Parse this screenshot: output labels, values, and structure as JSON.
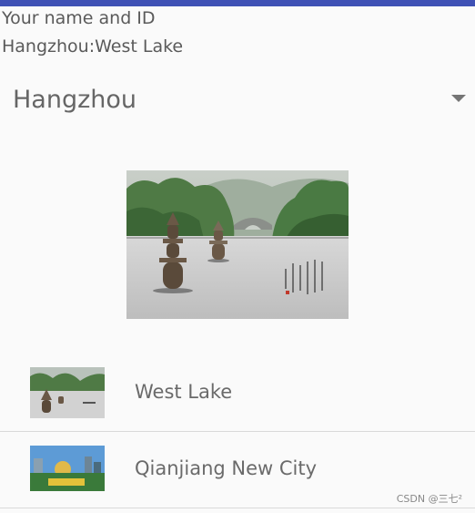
{
  "header": {
    "line1": "Your name and ID",
    "line2": "Hangzhou:West Lake"
  },
  "spinner": {
    "selected": "Hangzhou"
  },
  "hero_image": {
    "icon": "west-lake-pagodas-image"
  },
  "list": {
    "items": [
      {
        "label": "West Lake",
        "icon": "west-lake-thumbnail"
      },
      {
        "label": "Qianjiang New City",
        "icon": "qianjiang-new-city-thumbnail"
      }
    ]
  },
  "watermark": "CSDN @三七²",
  "colors": {
    "app_bar": "#3f51b5",
    "background": "#fafafa",
    "divider": "#d9d9d9"
  }
}
